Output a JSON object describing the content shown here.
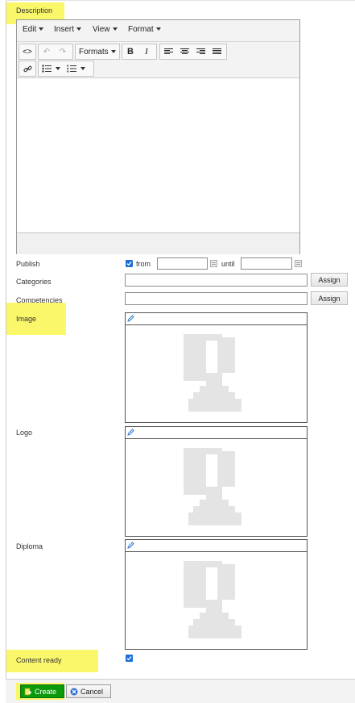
{
  "form": {
    "description_label": "Description",
    "publish_label": "Publish",
    "from_label": "from",
    "until_label": "until",
    "categories_label": "Categories",
    "competencies_label": "Competencies",
    "assign_label": "Assign",
    "image_label": "Image",
    "logo_label": "Logo",
    "diploma_label": "Diploma",
    "content_ready_label": "Content ready"
  },
  "editor": {
    "menus": [
      "Edit",
      "Insert",
      "View",
      "Format"
    ],
    "formats_label": "Formats",
    "bold_label": "B",
    "italic_label": "I"
  },
  "footer": {
    "create_label": "Create",
    "cancel_label": "Cancel"
  },
  "colors": {
    "highlight": "#fbf76b",
    "create_bg": "#0b9a0b",
    "checkbox": "#1e6fd8"
  }
}
